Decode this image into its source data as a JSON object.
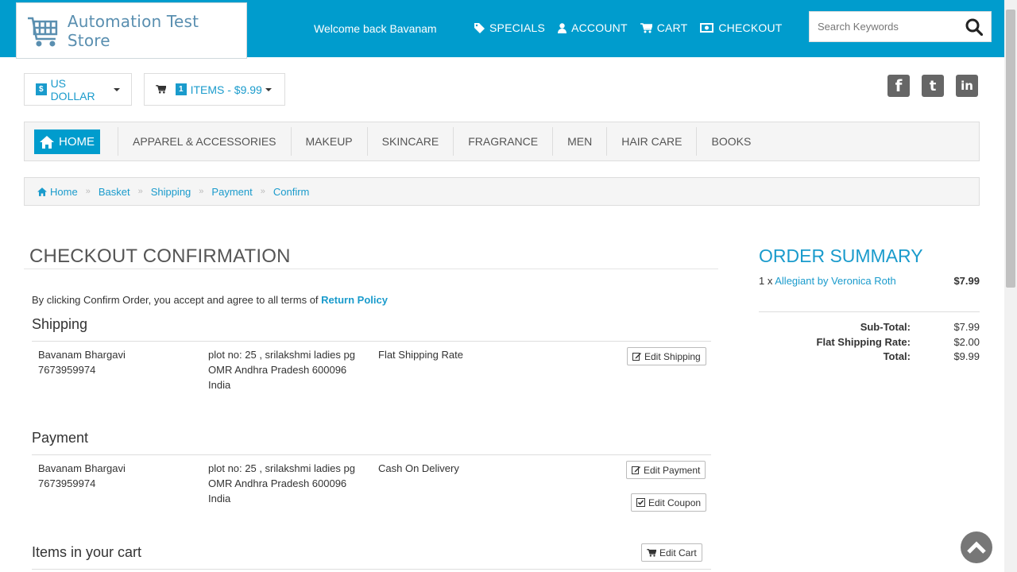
{
  "header": {
    "logo_text": "Automation Test Store",
    "welcome": "Welcome back Bavanam",
    "nav": [
      {
        "label": "SPECIALS",
        "icon": "tag-icon"
      },
      {
        "label": "ACCOUNT",
        "icon": "user-icon"
      },
      {
        "label": "CART",
        "icon": "cart-icon"
      },
      {
        "label": "CHECKOUT",
        "icon": "money-icon"
      }
    ],
    "search_placeholder": "Search Keywords"
  },
  "toolbar": {
    "currency_badge": "$",
    "currency_label": "US DOLLAR",
    "cart_badge": "1",
    "cart_label": "ITEMS - $9.99"
  },
  "socials": [
    "f",
    "t",
    "in"
  ],
  "menu": {
    "home": "HOME",
    "categories": [
      "APPAREL & ACCESSORIES",
      "MAKEUP",
      "SKINCARE",
      "FRAGRANCE",
      "MEN",
      "HAIR CARE",
      "BOOKS"
    ]
  },
  "breadcrumb": [
    "Home",
    "Basket",
    "Shipping",
    "Payment",
    "Confirm"
  ],
  "main": {
    "title": "CHECKOUT CONFIRMATION",
    "terms_text": "By clicking Confirm Order, you accept and agree to all terms of ",
    "terms_link": "Return Policy",
    "shipping": {
      "title": "Shipping",
      "name": "Bavanam Bhargavi",
      "phone": "7673959974",
      "address1": "plot no: 25 , srilakshmi ladies pg",
      "address2": "OMR Andhra Pradesh 600096",
      "address3": "India",
      "method": "Flat Shipping Rate",
      "edit_label": "Edit Shipping"
    },
    "payment": {
      "title": "Payment",
      "name": "Bavanam Bhargavi",
      "phone": "7673959974",
      "address1": "plot no: 25 , srilakshmi ladies pg",
      "address2": "OMR Andhra Pradesh 600096",
      "address3": "India",
      "method": "Cash On Delivery",
      "edit_label": "Edit Payment",
      "coupon_label": "Edit Coupon"
    },
    "cart": {
      "title": "Items in your cart",
      "edit_label": "Edit Cart"
    }
  },
  "summary": {
    "title": "ORDER SUMMARY",
    "item_qty": "1 x",
    "item_name": "Allegiant by Veronica Roth",
    "item_price": "$7.99",
    "rows": [
      {
        "label": "Sub-Total:",
        "value": "$7.99"
      },
      {
        "label": "Flat Shipping Rate:",
        "value": "$2.00"
      },
      {
        "label": "Total:",
        "value": "$9.99"
      }
    ]
  },
  "colors": {
    "brand": "#009ccd",
    "link": "#1a9bcc"
  }
}
